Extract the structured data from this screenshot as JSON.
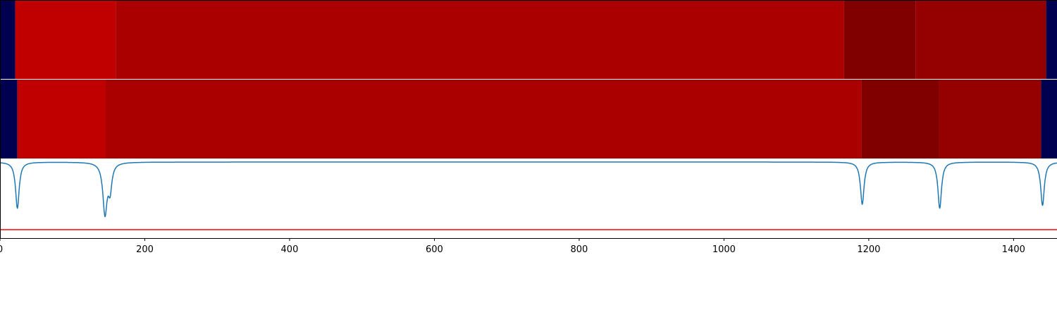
{
  "chart_data": {
    "type": "line",
    "title": "",
    "xlabel": "",
    "ylabel": "",
    "xlim": [
      0,
      1460
    ],
    "ylim": [
      -1.35,
      0.05
    ],
    "grid": false,
    "xticks": [
      {
        "value": 0,
        "label": "0"
      },
      {
        "value": 200,
        "label": "200"
      },
      {
        "value": 400,
        "label": "400"
      },
      {
        "value": 600,
        "label": "600"
      },
      {
        "value": 800,
        "label": "800"
      },
      {
        "value": 1000,
        "label": "1000"
      },
      {
        "value": 1200,
        "label": "1200"
      },
      {
        "value": 1400,
        "label": "1400"
      }
    ],
    "segment_bands": [
      {
        "name": "",
        "segments": [
          {
            "start": 0,
            "end": 21,
            "color": "#000050"
          },
          {
            "start": 21,
            "end": 160,
            "color": "#c00000"
          },
          {
            "start": 160,
            "end": 1166,
            "color": "#aa0000"
          },
          {
            "start": 1166,
            "end": 1265,
            "color": "#800000"
          },
          {
            "start": 1265,
            "end": 1445,
            "color": "#950000"
          },
          {
            "start": 1445,
            "end": 1460,
            "color": "#000050"
          }
        ]
      },
      {
        "name": "",
        "segments": [
          {
            "start": 0,
            "end": 24,
            "color": "#000050"
          },
          {
            "start": 24,
            "end": 146,
            "color": "#c00000"
          },
          {
            "start": 146,
            "end": 1190,
            "color": "#aa0000"
          },
          {
            "start": 1190,
            "end": 1297,
            "color": "#800000"
          },
          {
            "start": 1297,
            "end": 1438,
            "color": "#950000"
          },
          {
            "start": 1438,
            "end": 1460,
            "color": "#000050"
          }
        ]
      }
    ],
    "signal": {
      "name": "",
      "color": "#1f77b4",
      "baseline": 0,
      "dips": [
        {
          "x": 24,
          "depth": -0.82,
          "width": 3.0
        },
        {
          "x": 145,
          "depth": -0.9,
          "width": 3.5
        },
        {
          "x": 152,
          "depth": -0.45,
          "width": 3.0
        },
        {
          "x": 1191,
          "depth": -0.75,
          "width": 3.0
        },
        {
          "x": 1298,
          "depth": -0.82,
          "width": 3.0
        },
        {
          "x": 1440,
          "depth": -0.77,
          "width": 3.0
        }
      ]
    },
    "threshold": {
      "value": -1.2,
      "color": "#ff0000"
    }
  }
}
